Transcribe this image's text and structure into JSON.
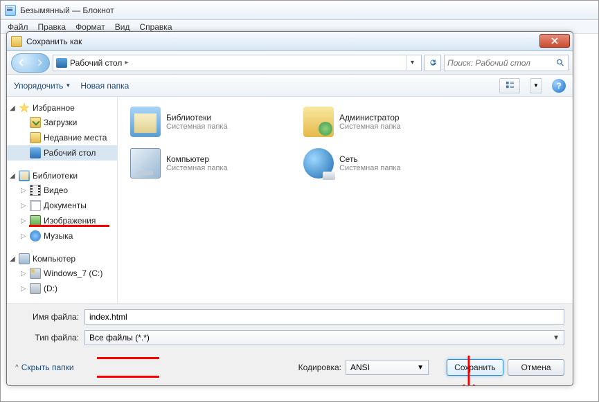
{
  "notepad": {
    "title": "Безымянный — Блокнот",
    "menu": [
      "Файл",
      "Правка",
      "Формат",
      "Вид",
      "Справка"
    ]
  },
  "dialog": {
    "title": "Сохранить как",
    "breadcrumb": {
      "location": "Рабочий стол"
    },
    "search": {
      "placeholder": "Поиск: Рабочий стол"
    },
    "toolbar": {
      "organize": "Упорядочить",
      "newfolder": "Новая папка"
    },
    "tree": {
      "favorites": {
        "label": "Избранное",
        "items": [
          {
            "label": "Загрузки",
            "icon": "fav-download"
          },
          {
            "label": "Недавние места",
            "icon": "recent-icon"
          },
          {
            "label": "Рабочий стол",
            "icon": "desktop-icon",
            "selected": true
          }
        ]
      },
      "libraries": {
        "label": "Библиотеки",
        "items": [
          {
            "label": "Видео",
            "icon": "video-icon"
          },
          {
            "label": "Документы",
            "icon": "doc-icon"
          },
          {
            "label": "Изображения",
            "icon": "img-icon"
          },
          {
            "label": "Музыка",
            "icon": "music-icon"
          }
        ]
      },
      "computer": {
        "label": "Компьютер",
        "items": [
          {
            "label": "Windows_7 (C:)",
            "icon": "drive-icon win"
          },
          {
            "label": "(D:)",
            "icon": "drive-icon"
          }
        ]
      }
    },
    "content": {
      "items": [
        {
          "name": "Библиотеки",
          "sub": "Системная папка",
          "icon": "big-lib"
        },
        {
          "name": "Администратор",
          "sub": "Системная папка",
          "icon": "big-admin"
        },
        {
          "name": "Компьютер",
          "sub": "Системная папка",
          "icon": "big-pc"
        },
        {
          "name": "Сеть",
          "sub": "Системная папка",
          "icon": "big-net"
        }
      ]
    },
    "fields": {
      "filename_label": "Имя файла:",
      "filename_value": "index.html",
      "filetype_label": "Тип файла:",
      "filetype_value": "Все файлы  (*.*)"
    },
    "footer": {
      "hide_folders": "Скрыть папки",
      "encoding_label": "Кодировка:",
      "encoding_value": "ANSI",
      "save": "Сохранить",
      "cancel": "Отмена"
    }
  }
}
